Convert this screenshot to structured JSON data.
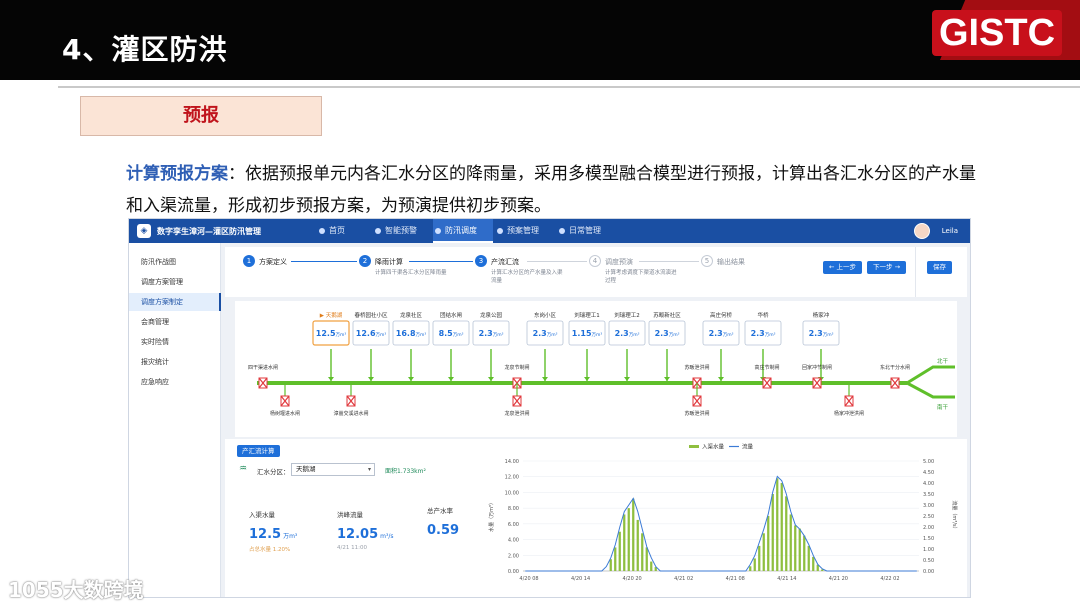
{
  "slide": {
    "title": "4、灌区防洪",
    "logo": "GISTC",
    "tag": "预报",
    "desc_highlight": "计算预报方案",
    "desc_rest": "：依据预报单元内各汇水分区的降雨量，采用多模型融合模型进行预报，计算出各汇水分区的产水量和入渠流量，形成初步预报方案，为预演提供初步预案。",
    "watermark": "1055大数跨境"
  },
  "app": {
    "name": "数字孪生漳河—灌区防汛管理",
    "nav": [
      {
        "label": "首页"
      },
      {
        "label": "智能预警"
      },
      {
        "label": "防汛调度",
        "active": true
      },
      {
        "label": "预案管理"
      },
      {
        "label": "日常管理"
      }
    ],
    "user": "Leila",
    "sidebar": [
      {
        "label": "防汛作战图"
      },
      {
        "label": "调度方案管理"
      },
      {
        "label": "调度方案制定",
        "active": true
      },
      {
        "label": "会商管理"
      },
      {
        "label": "实时险情"
      },
      {
        "label": "报灾统计"
      },
      {
        "label": "应急响应"
      }
    ],
    "steps": [
      {
        "num": "1",
        "title": "方案定义",
        "desc": "",
        "state": "done"
      },
      {
        "num": "2",
        "title": "降雨计算",
        "desc": "计算四干渠各汇水分区降雨量",
        "state": "done"
      },
      {
        "num": "3",
        "title": "产流汇流",
        "desc": "计算汇水分区的产水量及入渠流量",
        "state": "active"
      },
      {
        "num": "4",
        "title": "调度预演",
        "desc": "计算考虑调度下渠道水流演进过程",
        "state": "pending"
      },
      {
        "num": "5",
        "title": "输出结果",
        "desc": "",
        "state": "pending"
      }
    ],
    "buttons": {
      "prev": "← 上一步",
      "next": "下一步 →",
      "save": "保存"
    },
    "network": {
      "zones": [
        {
          "name": "天鹅湖",
          "value": "12.5",
          "unit": "万m³",
          "selected": true
        },
        {
          "name": "春桥园社小区",
          "value": "12.6",
          "unit": "万m³"
        },
        {
          "name": "龙泉社区",
          "value": "16.8",
          "unit": "万m³"
        },
        {
          "name": "团结水闸",
          "value": "8.5",
          "unit": "万m³"
        },
        {
          "name": "龙泉公园",
          "value": "2.3",
          "unit": "万m³"
        },
        {
          "name": "东岗小区",
          "value": "2.3",
          "unit": "万m³"
        },
        {
          "name": "刘瑞理工1",
          "value": "1.15",
          "unit": "万m³"
        },
        {
          "name": "刘瑞理工2",
          "value": "2.3",
          "unit": "万m³"
        },
        {
          "name": "苏畈新社区",
          "value": "2.3",
          "unit": "万m³"
        },
        {
          "name": "高庄何桥",
          "value": "2.3",
          "unit": "万m³"
        },
        {
          "name": "华桥",
          "value": "2.3",
          "unit": "万m³"
        },
        {
          "name": "杨家冲",
          "value": "2.3",
          "unit": "万m³"
        }
      ],
      "gates_top": [
        "四干渠进水闸",
        "龙泉节制闸",
        "苏畈泄洪闸",
        "高庄节制闸",
        "回家冲节制闸",
        "东北干分水闸"
      ],
      "gates_bottom": [
        "杨树堰进水闸",
        "漳嵩交溪进水闸",
        "龙泉泄洪闸",
        "苏畈泄洪闸",
        "杨家冲泄洪闸"
      ],
      "branches": [
        "北干",
        "南干"
      ]
    },
    "calc": {
      "button": "产汇流计算",
      "zone_label": "汇水分区：",
      "zone_value": "天鹅湖",
      "area": "面积1.733km²",
      "stats": [
        {
          "label": "入渠水量",
          "value": "12.5",
          "unit": "万m³",
          "sub": "占总水量 1.20%"
        },
        {
          "label": "洪峰流量",
          "value": "12.05",
          "unit": "m³/s",
          "sub": "4/21 11:00"
        },
        {
          "label": "总产水率",
          "value": "0.59",
          "unit": "",
          "sub": ""
        }
      ]
    },
    "chart_data": {
      "type": "bar",
      "legend": [
        "入渠水量",
        "流量"
      ],
      "legend_position": "top-center",
      "x_ticks": [
        "4/20 08",
        "4/20 14",
        "4/20 20",
        "4/21 02",
        "4/21 08",
        "4/21 14",
        "4/21 20",
        "4/22 02"
      ],
      "y_left": {
        "label": "水量（万m³）",
        "ticks": [
          "0.00",
          "2.00",
          "4.00",
          "6.00",
          "8.00",
          "10.00",
          "12.00",
          "14.00"
        ],
        "range": [
          0,
          14
        ]
      },
      "y_right": {
        "label": "流量（m³/s）",
        "ticks": [
          "0.00",
          "0.50",
          "1.00",
          "1.50",
          "2.00",
          "2.50",
          "3.00",
          "3.50",
          "4.00",
          "4.50",
          "5.00"
        ],
        "range": [
          0,
          5
        ]
      },
      "series": [
        {
          "name": "入渠水量",
          "kind": "bar",
          "color": "#8fbf3f",
          "values": [
            0,
            0,
            0,
            0,
            0,
            0,
            0,
            0,
            0,
            0,
            0,
            0,
            0,
            0,
            0,
            0,
            0,
            0,
            0,
            1.5,
            3.0,
            5.0,
            7.2,
            8.0,
            9.2,
            6.5,
            4.8,
            3.0,
            1.2,
            0.5,
            0,
            0,
            0,
            0,
            0,
            0,
            0,
            0,
            0,
            0,
            0,
            0,
            0,
            0,
            0,
            0,
            0,
            0,
            0,
            0,
            0.6,
            1.6,
            3.2,
            4.8,
            7.0,
            9.8,
            11.8,
            11.2,
            9.5,
            7.2,
            5.8,
            5.4,
            4.5,
            3.2,
            1.8,
            0.8,
            0.2,
            0,
            0,
            0,
            0,
            0,
            0,
            0,
            0,
            0,
            0,
            0,
            0,
            0,
            0,
            0,
            0,
            0,
            0,
            0,
            0,
            0
          ]
        },
        {
          "name": "流量",
          "kind": "line",
          "color": "#3c7bd6",
          "values": [
            0,
            0,
            0,
            0,
            0,
            0,
            0,
            0,
            0,
            0,
            0,
            0,
            0,
            0,
            0,
            0,
            0,
            0,
            0.2,
            0.6,
            1.2,
            2.0,
            2.7,
            3.0,
            3.3,
            2.7,
            1.9,
            1.1,
            0.6,
            0.2,
            0,
            0,
            0,
            0,
            0,
            0,
            0,
            0,
            0,
            0,
            0,
            0,
            0,
            0,
            0,
            0,
            0,
            0,
            0,
            0,
            0.3,
            0.7,
            1.3,
            1.9,
            2.6,
            3.6,
            4.3,
            4.1,
            3.5,
            2.7,
            2.1,
            1.9,
            1.6,
            1.2,
            0.7,
            0.3,
            0.1,
            0,
            0,
            0,
            0,
            0,
            0,
            0,
            0,
            0,
            0,
            0,
            0,
            0,
            0,
            0,
            0,
            0,
            0,
            0,
            0,
            0
          ]
        }
      ]
    }
  },
  "colors": {
    "accent": "#1e6fd9",
    "brand_red": "#c8101b",
    "canal_green": "#5fbf2a",
    "gate_red": "#e0393e"
  }
}
